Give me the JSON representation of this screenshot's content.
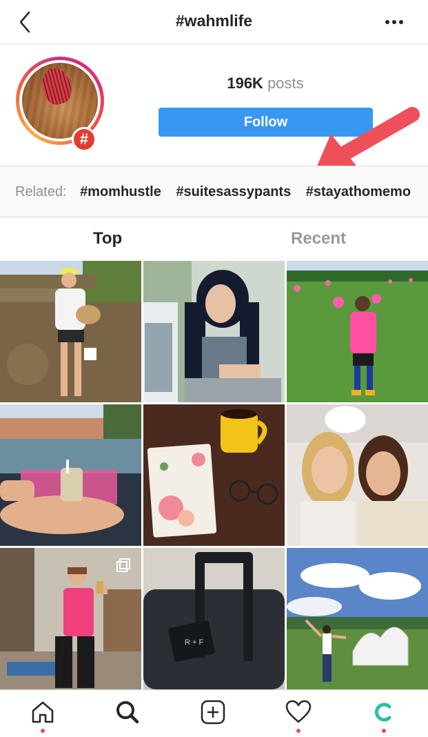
{
  "topbar": {
    "title": "#wahmlife"
  },
  "header": {
    "posts_count": "196K",
    "posts_label": "posts",
    "follow_label": "Follow",
    "hash_symbol": "#"
  },
  "related": {
    "label": "Related:",
    "tags": [
      "#momhustle",
      "#suitesassypants",
      "#stayathomemo"
    ]
  },
  "tabs": {
    "top": "Top",
    "recent": "Recent"
  },
  "grid": {
    "photos": [
      "woman-with-chicken",
      "woman-with-laptop",
      "boy-soccer-field",
      "pool-and-drink",
      "planner-and-mug",
      "two-women-selfie",
      "woman-gym-selfie",
      "suitcase-luggage-tag",
      "woman-park-sculpture"
    ],
    "luggage_tag_text": "R + F"
  },
  "colors": {
    "follow_button": "#3897f0",
    "arrow": "#ef4f59",
    "badge": "#e33d32",
    "notification_dot": "#ed4956"
  },
  "bottom_nav": [
    "home-icon",
    "search-icon",
    "new-post-icon",
    "activity-heart-icon",
    "profile-icon"
  ]
}
